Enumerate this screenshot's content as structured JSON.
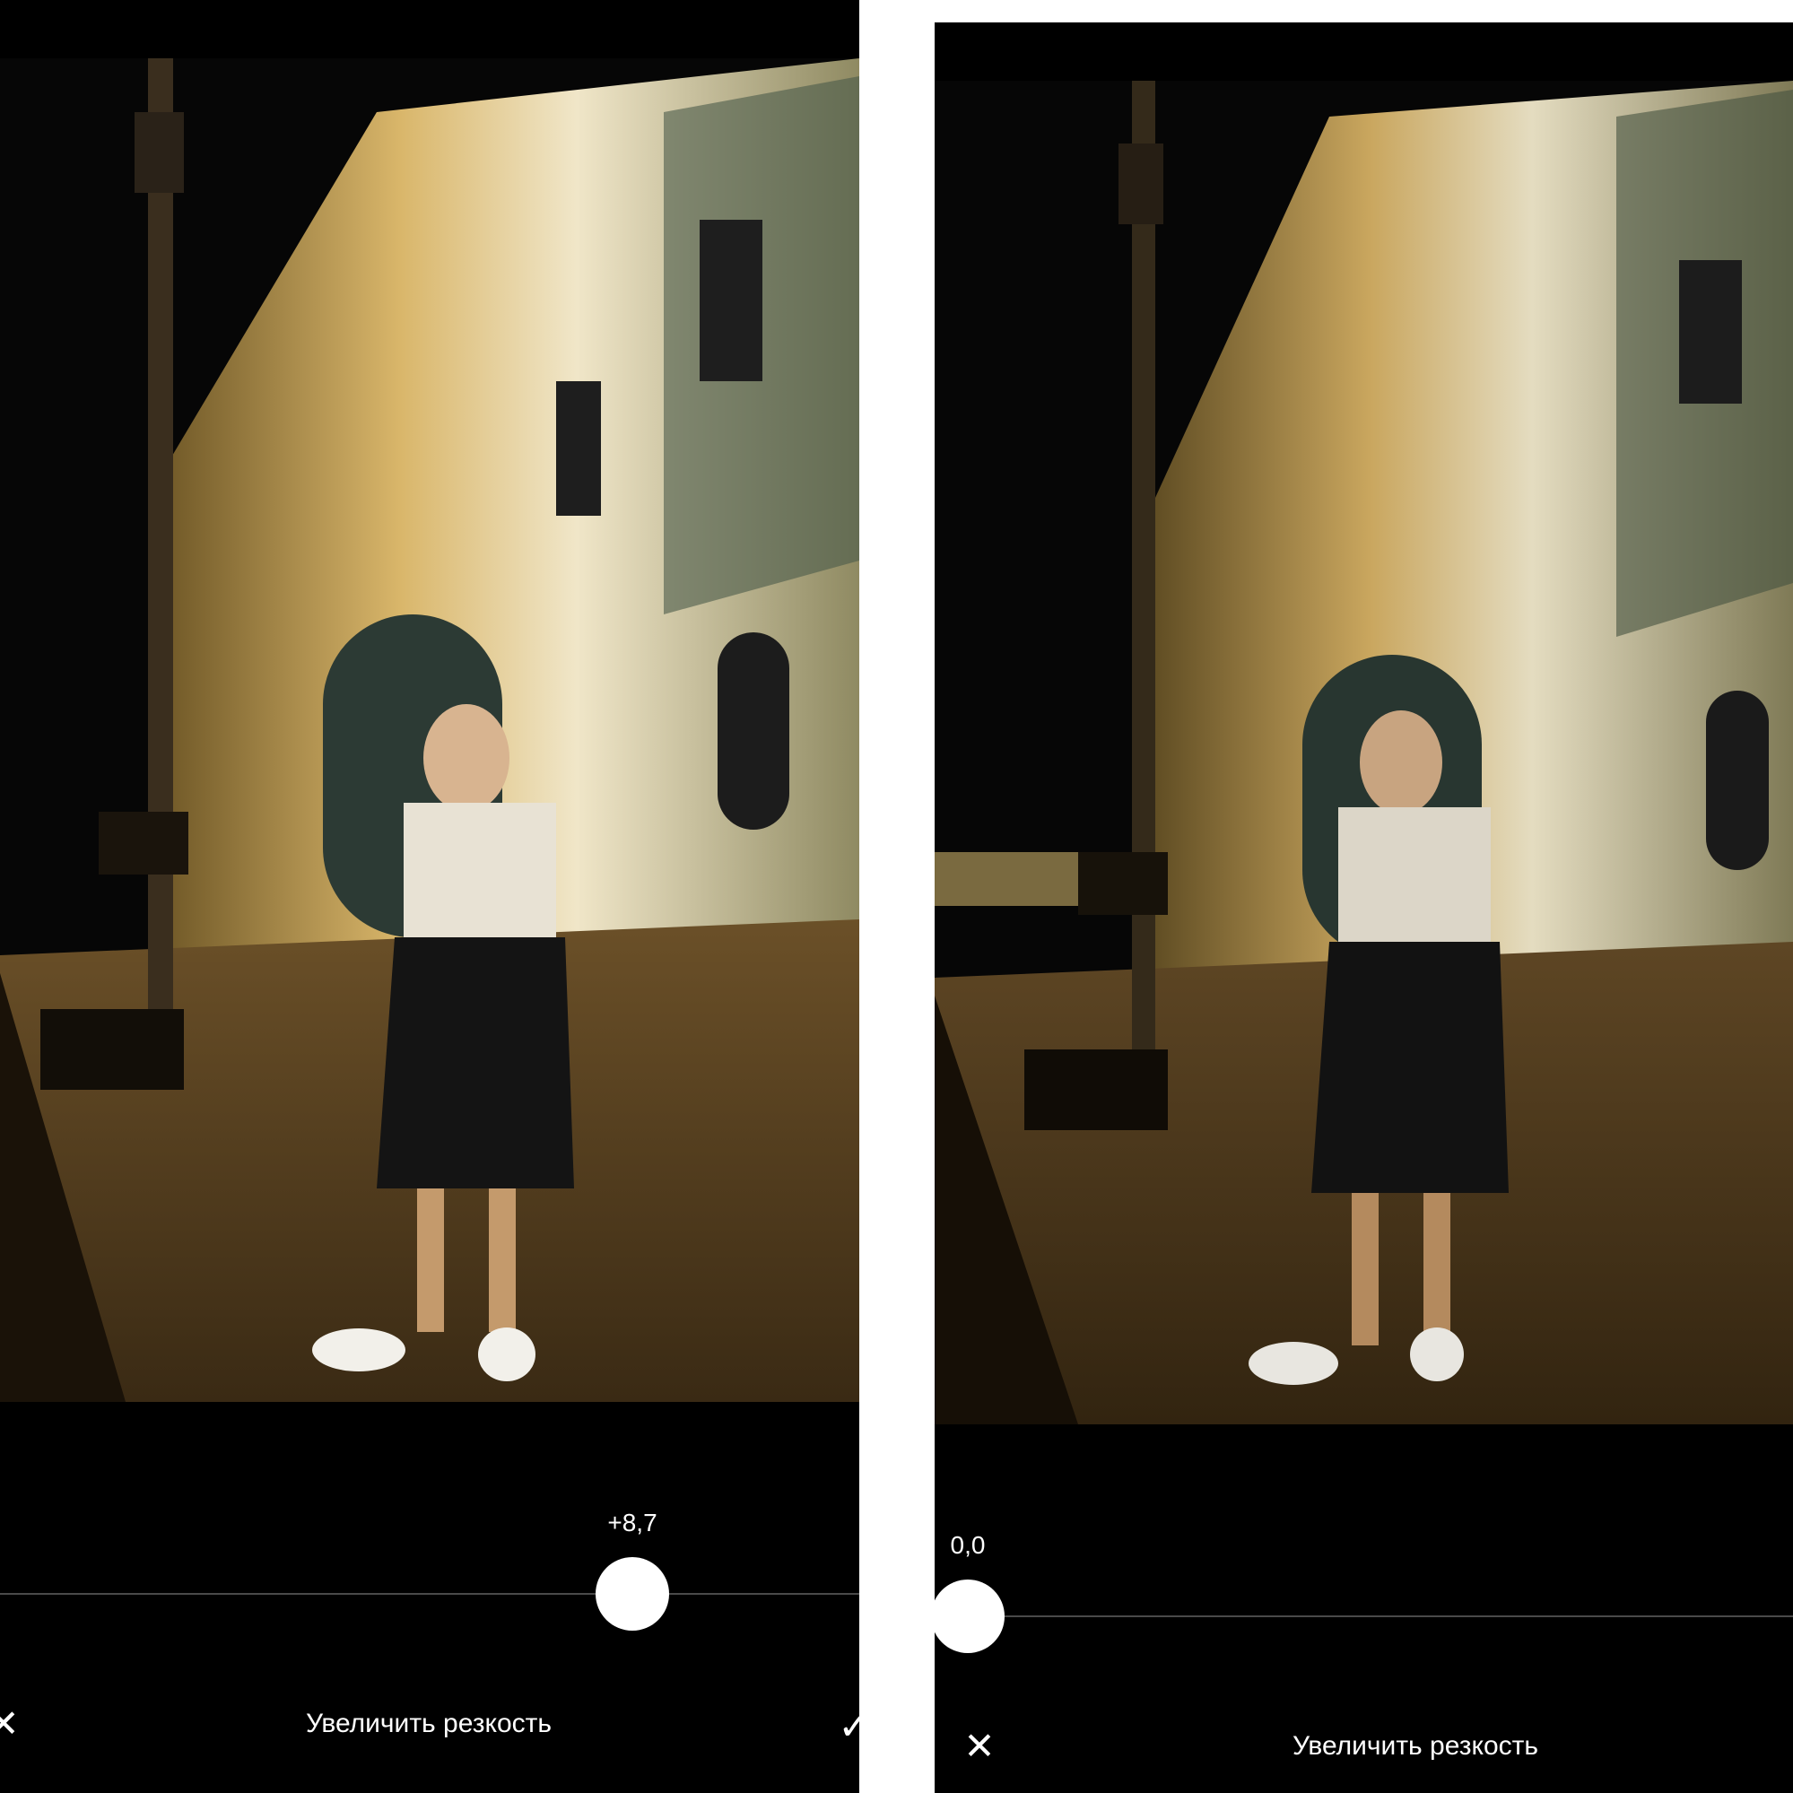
{
  "left_panel": {
    "value": "+8,7",
    "slider_fraction": 0.735,
    "title": "Увеличить резкость"
  },
  "right_panel": {
    "value": "0,0",
    "slider_fraction": 0.0,
    "title": "Увеличить резкость"
  },
  "icons": {
    "cancel": "close-icon",
    "confirm": "check-icon"
  },
  "colors": {
    "background": "#000000",
    "divider": "#ffffff",
    "thumb": "#ffffff",
    "track": "#4a4a4a"
  }
}
